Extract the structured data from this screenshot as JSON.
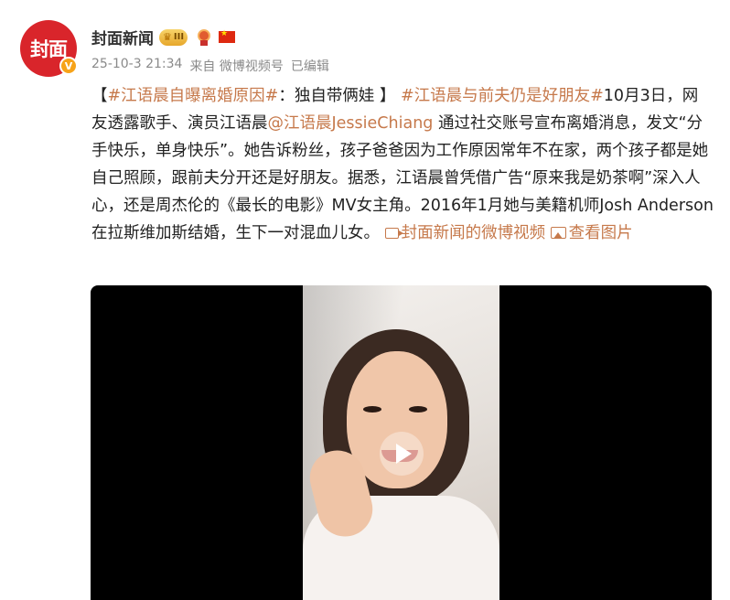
{
  "account": {
    "name": "封面新闻",
    "avatar_text": "封面",
    "verified_mark": "V",
    "badge_level": "III"
  },
  "meta": {
    "time": "25-10-3 21:34",
    "source": "来自 微博视频号",
    "edited": "已编辑"
  },
  "post": {
    "p1": "【",
    "tag1": "#江语晨自曝离婚原因#",
    "p2": "：独自带俩娃 】",
    "tag2": "#江语晨与前夫仍是好朋友#",
    "p3": "10月3日，网友透露歌手、演员江语晨",
    "mention": "@江语晨JessieChiang",
    "p4": " 通过社交账号宣布离婚消息，发文“分手快乐，单身快乐”。她告诉粉丝，孩子爸爸因为工作原因常年不在家，两个孩子都是她自己照顾，跟前夫分开还是好朋友。据悉，江语晨曾凭借广告“原来我是奶茶啊”深入人心，还是周杰伦的《最长的电影》MV女主角。2016年1月她与美籍机师Josh Anderson在拉斯维加斯结婚，生下一对混血儿女。",
    "video_link": "封面新闻的微博视频",
    "image_link": "查看图片"
  },
  "icons": {
    "badge": "crown-badge-icon",
    "medal": "medal-icon",
    "flag": "china-flag-icon",
    "video_link": "video-link-icon",
    "image_link": "image-icon",
    "play": "play-icon"
  },
  "colors": {
    "brand": "#d9252b",
    "link": "#c6794b",
    "meta_text": "#8a8a8a",
    "video_bg": "#000000"
  }
}
